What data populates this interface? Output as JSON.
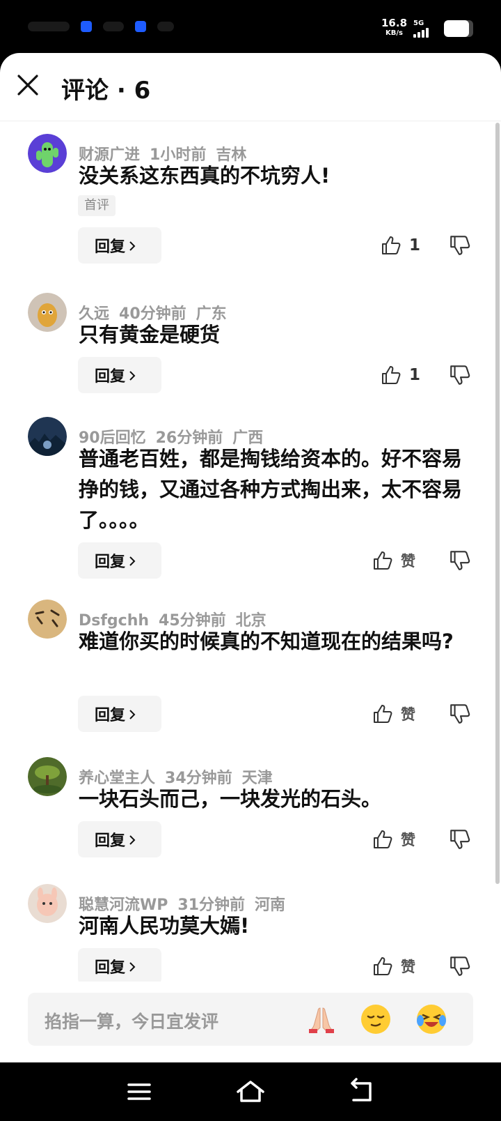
{
  "status_bar": {
    "speed_value": "16.8",
    "speed_unit": "KB/s",
    "network": "5G",
    "battery_level": 0.85
  },
  "header": {
    "title": "评论 · 6"
  },
  "labels": {
    "reply": "回复",
    "like": "赞"
  },
  "comments": [
    {
      "user": "财源广进",
      "time": "1小时前",
      "location": "吉林",
      "text": "没关系这东西真的不坑穷人!",
      "tag": "首评",
      "likes": "1"
    },
    {
      "user": "久远",
      "time": "40分钟前",
      "location": "广东",
      "text": "只有黄金是硬货",
      "likes": "1"
    },
    {
      "user": "90后回忆",
      "time": "26分钟前",
      "location": "广西",
      "text": "普通老百姓，都是掏钱给资本的。好不容易挣的钱，又通过各种方式掏出来，太不容易了。。。。",
      "likes": ""
    },
    {
      "user": "Dsfgchh",
      "time": "45分钟前",
      "location": "北京",
      "text": "难道你买的时候真的不知道现在的结果吗?",
      "likes": ""
    },
    {
      "user": "养心堂主人",
      "time": "34分钟前",
      "location": "天津",
      "text": "一块石头而己，一块发光的石头。",
      "likes": ""
    },
    {
      "user": "聪慧河流WP",
      "time": "31分钟前",
      "location": "河南",
      "text": "河南人民功莫大嫣!",
      "likes": ""
    }
  ],
  "input": {
    "placeholder": "掐指一算，今日宜发评"
  },
  "icons": {
    "close": "close-icon",
    "like": "thumb-up-icon",
    "dislike": "thumb-down-icon",
    "emoji_1": "praying-hands-emoji",
    "emoji_2": "smirk-face-emoji",
    "emoji_3": "laughing-tears-emoji",
    "nav_menu": "menu-icon",
    "nav_home": "home-icon",
    "nav_back": "back-icon"
  },
  "colors": {
    "text_primary": "#111111",
    "text_meta": "#999999",
    "button_bg": "#f4f4f4"
  }
}
